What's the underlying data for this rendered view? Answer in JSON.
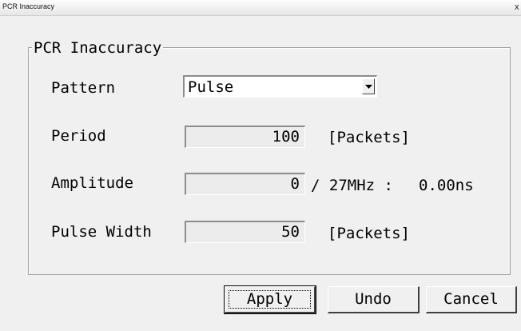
{
  "window": {
    "title": "PCR Inaccuracy",
    "close_glyph": "x"
  },
  "group": {
    "title": "PCR Inaccuracy"
  },
  "fields": {
    "pattern": {
      "label": "Pattern",
      "value": "Pulse"
    },
    "period": {
      "label": "Period",
      "value": "100",
      "unit": "[Packets]"
    },
    "amplitude": {
      "label": "Amplitude",
      "value": "0",
      "suffix": "/ 27MHz :",
      "ns_value": "0.00ns"
    },
    "pulse_width": {
      "label": "Pulse Width",
      "value": "50",
      "unit": "[Packets]"
    }
  },
  "buttons": {
    "apply": "Apply",
    "undo": "Undo",
    "cancel": "Cancel"
  },
  "icons": {
    "dropdown": "chevron-down-icon",
    "close": "close-icon"
  }
}
